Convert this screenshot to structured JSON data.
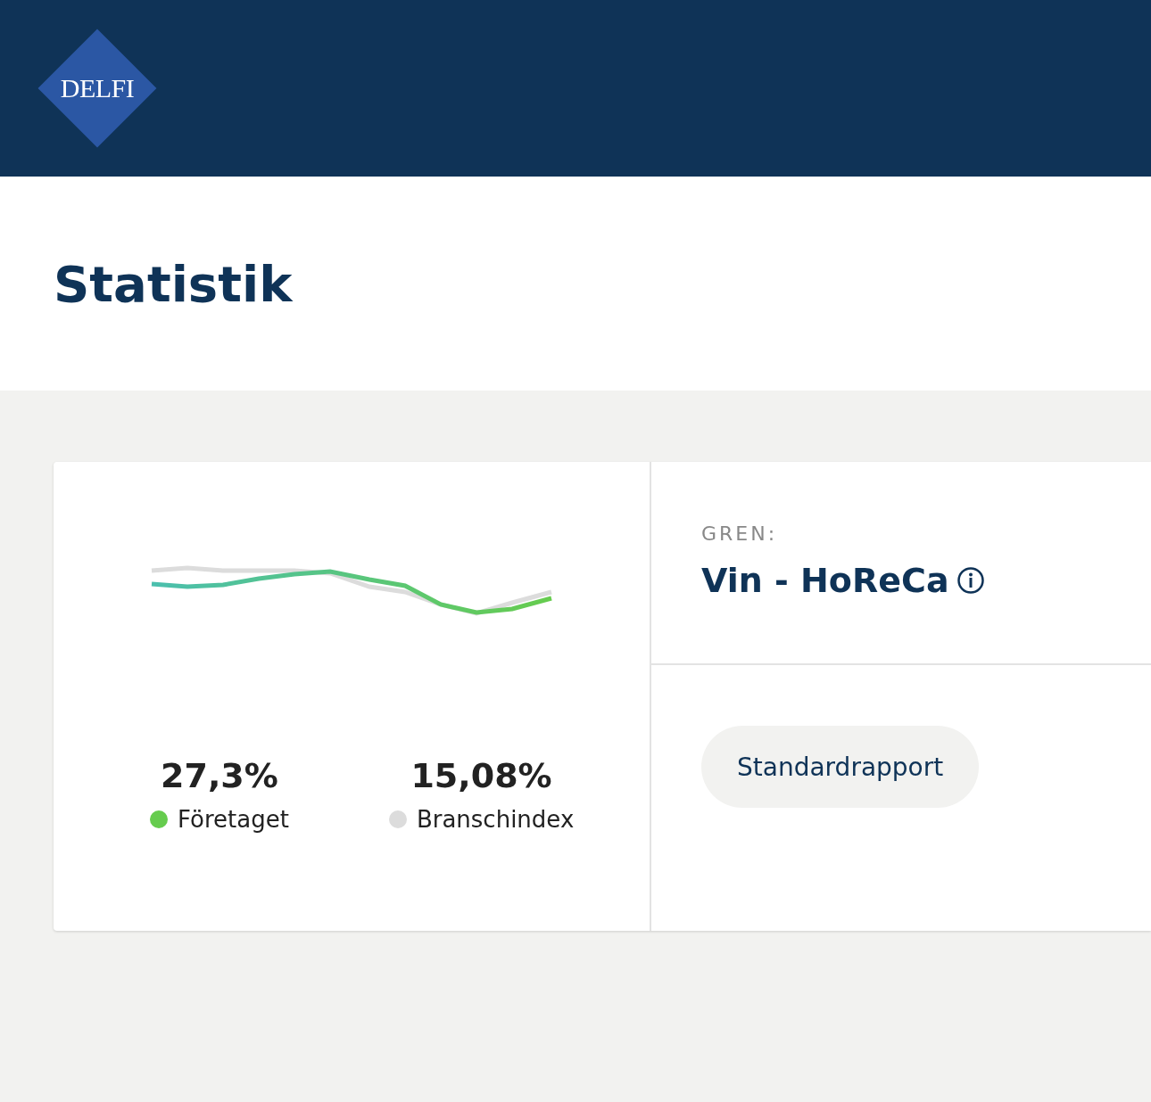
{
  "header": {
    "logo": "DELFI"
  },
  "page": {
    "title": "Statistik"
  },
  "stats": [
    {
      "value": "27,3%",
      "label": "Företaget",
      "color": "#66cc4e"
    },
    {
      "value": "15,08%",
      "label": "Branschindex",
      "color": "#dcdcdc"
    }
  ],
  "branch": {
    "label": "GREN:",
    "name": "Vin - HoReCa"
  },
  "report_button": {
    "label": "Standardrapport"
  }
}
